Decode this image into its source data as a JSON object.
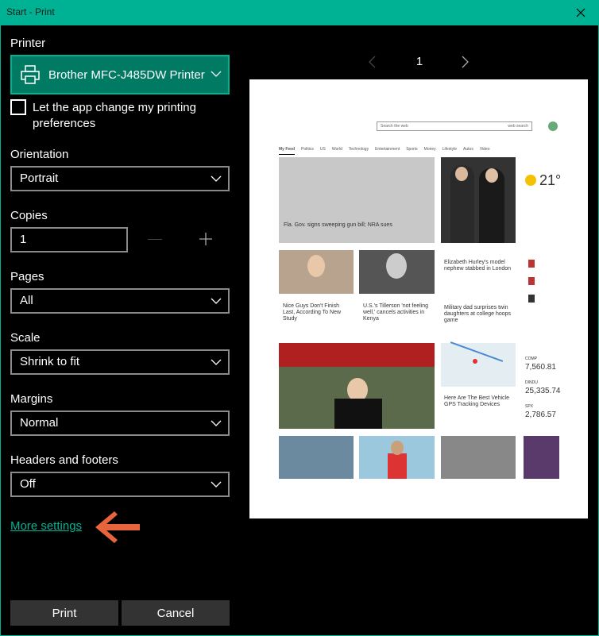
{
  "window": {
    "title": "Start - Print"
  },
  "printer": {
    "label": "Printer",
    "selected": "Brother MFC-J485DW Printer"
  },
  "app_change": {
    "label": "Let the app change my printing preferences"
  },
  "orientation": {
    "label": "Orientation",
    "selected": "Portrait"
  },
  "copies": {
    "label": "Copies",
    "value": "1"
  },
  "pages": {
    "label": "Pages",
    "selected": "All"
  },
  "scale": {
    "label": "Scale",
    "selected": "Shrink to fit"
  },
  "margins": {
    "label": "Margins",
    "selected": "Normal"
  },
  "headers": {
    "label": "Headers and footers",
    "selected": "Off"
  },
  "more_settings": "More settings",
  "buttons": {
    "print": "Print",
    "cancel": "Cancel"
  },
  "pager": {
    "page": "1"
  },
  "preview": {
    "search_placeholder": "Search the web",
    "search_button": "web search",
    "nav": [
      "My Feed",
      "Politics",
      "US",
      "World",
      "Technology",
      "Entertainment",
      "Sports",
      "Money",
      "Lifestyle",
      "Autos",
      "Video"
    ],
    "headline_main": "Fla. Gov. signs sweeping gun bill; NRA sues",
    "headline_right": "Elizabeth Hurley's model nephew stabbed in London",
    "story1": "Nice Guys Don't Finish Last, According To New Study",
    "story2": "U.S.'s Tillerson 'not feeling well,' cancels activities in Kenya",
    "story3": "Military dad surprises twin daughters at college hoops game",
    "story4": "Here Are The Best Vehicle GPS Tracking Devices",
    "weather_temp": "21°",
    "markets": [
      "7,560.81",
      "25,335.74",
      "2,786.57"
    ],
    "market_labels": [
      "COMP",
      "DINDU",
      "SPX"
    ],
    "colors": {
      "accent": "#00b294",
      "accent_dark": "#007a63",
      "arrow": "#e8643c"
    }
  }
}
